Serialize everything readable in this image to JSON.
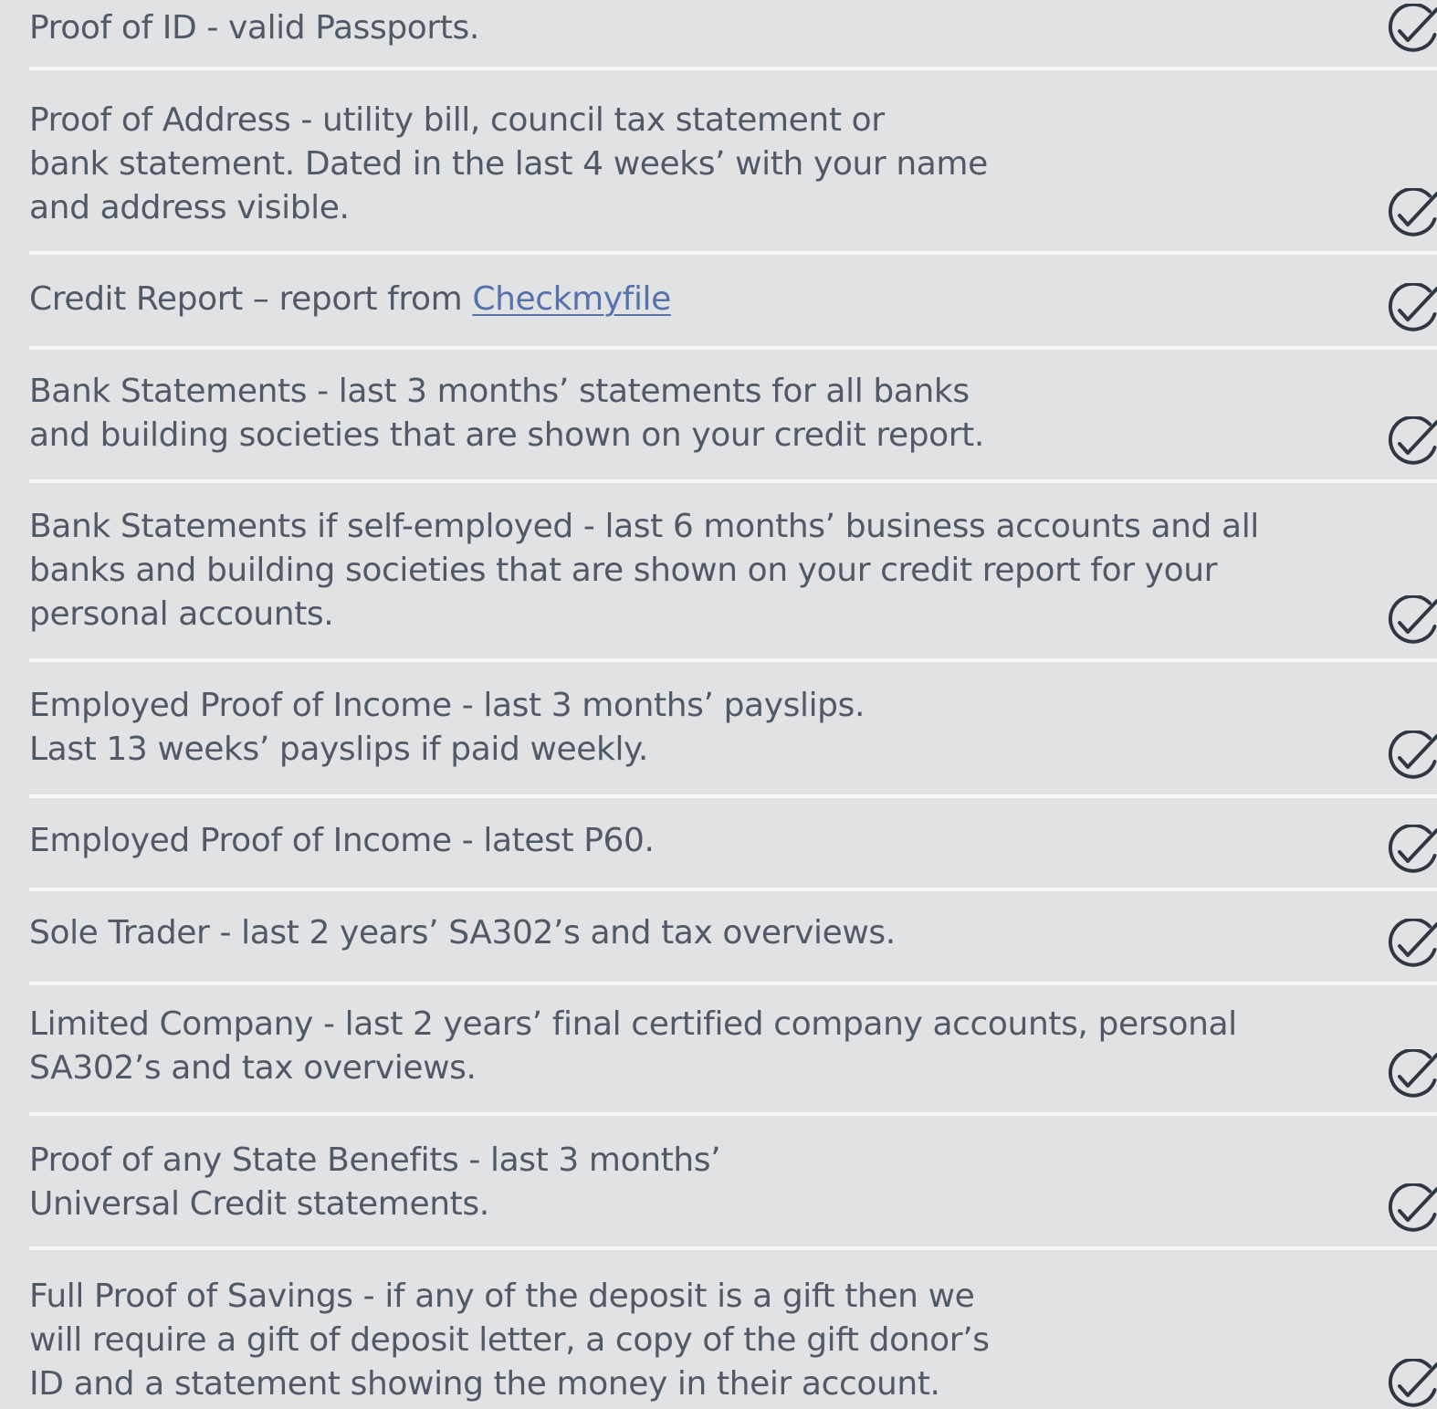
{
  "checklist": {
    "items": [
      {
        "lines": [
          "Proof of ID - valid Passports."
        ],
        "checked": true
      },
      {
        "lines": [
          "Proof of Address - utility bill, council tax statement or",
          "bank statement. Dated in the last 4 weeks’ with your name",
          "and address visible."
        ],
        "checked": true
      },
      {
        "prefix": "Credit Report – report from ",
        "link_text": "Checkmyfile",
        "checked": true
      },
      {
        "lines": [
          "Bank Statements - last 3 months’ statements for all banks",
          "and building societies that are shown on your credit report."
        ],
        "checked": true
      },
      {
        "lines": [
          "Bank Statements if self-employed - last 6 months’ business accounts and all",
          "banks and building societies that are shown on your credit report for your",
          "personal accounts."
        ],
        "checked": true
      },
      {
        "lines": [
          "Employed Proof of Income - last 3 months’ payslips.",
          "Last 13 weeks’ payslips if paid weekly."
        ],
        "checked": true
      },
      {
        "lines": [
          "Employed Proof of Income - latest P60."
        ],
        "checked": true
      },
      {
        "lines": [
          "Sole Trader - last 2 years’ SA302’s and tax overviews."
        ],
        "checked": true
      },
      {
        "lines": [
          "Limited Company - last 2 years’ final certified company accounts, personal",
          "SA302’s and tax overviews."
        ],
        "checked": true
      },
      {
        "lines": [
          "Proof of any State Benefits - last 3 months’",
          "Universal Credit statements."
        ],
        "checked": true
      },
      {
        "lines": [
          "Full Proof of Savings - if any of the deposit is a gift then we",
          "will require a gift of deposit letter, a copy of the gift donor’s",
          "ID and a statement showing the money in their account."
        ],
        "checked": true
      }
    ]
  },
  "colors": {
    "background": "#e1e2e4",
    "text": "#4f5a66",
    "link": "#5572ad",
    "divider": "#f7f7f8",
    "check_icon": "#2f3743"
  },
  "icons": {
    "check": "check-circle-icon"
  }
}
